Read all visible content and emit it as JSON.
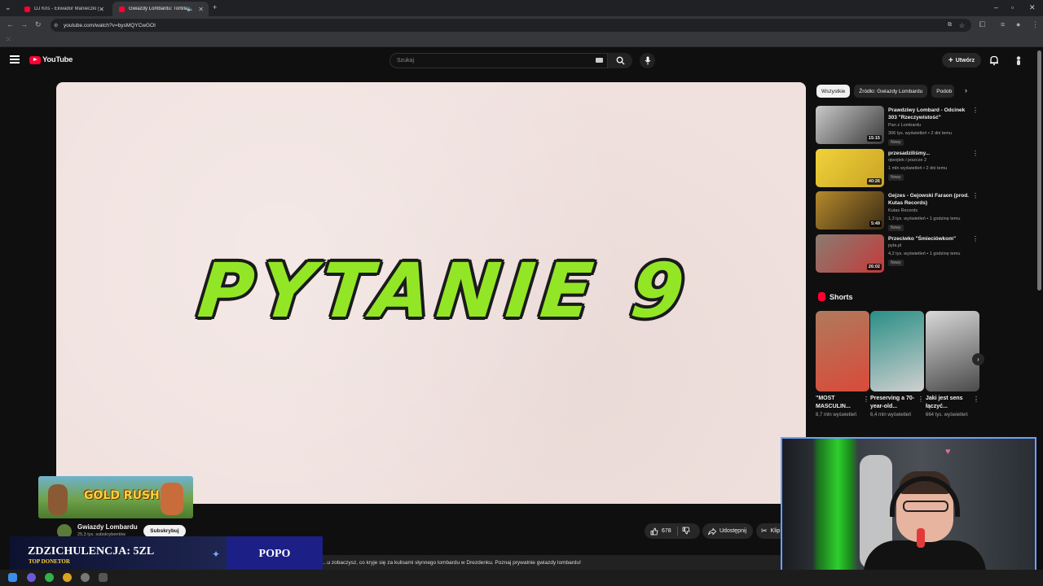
{
  "browser": {
    "tabs": [
      {
        "title": "DJ Kris - Ekwador Manieczki | ..."
      },
      {
        "title": "Gwiazdy Lombardu: Tortilla..."
      }
    ],
    "url": "youtube.com/watch?v=bysMQYCwGOI"
  },
  "header": {
    "logo_text": "YouTube",
    "search_placeholder": "Szukaj",
    "create_label": "Utwórz"
  },
  "player": {
    "video_text": "PYTANIE 9"
  },
  "channel": {
    "name": "Gwiazdy Lombardu",
    "subscribers": "25,3 tys. subskrybentów",
    "subscribe_label": "Subskrybuj"
  },
  "actions": {
    "likes": "678",
    "share_label": "Udostępnij",
    "clip_label": "Klip"
  },
  "description": {
    "text": "…u zobaczysz, co kryje się za kulisami słynnego lombardu w Drezdenku. Poznaj prywatnie gwiazdy lombardu!"
  },
  "chips": [
    "Wszystkie",
    "Źródło: Gwiazdy Lombardu",
    "Podob"
  ],
  "recommendations": [
    {
      "title": "Prawdziwy Lombard - Odcinek 303 \"Rzeczywistość\"",
      "channel": "Pan z Lombardu",
      "meta": "306 tys. wyświetleń • 2 dni temu",
      "badge": "Nowy",
      "duration": "15:15",
      "colors": [
        "#c9c9c9",
        "#3b3b3b"
      ]
    },
    {
      "title": "przesadziliśmy...",
      "channel": "ojwojtek i jeszcze 2",
      "meta": "1 mln wyświetleń • 2 dni temu",
      "badge": "Nowy",
      "duration": "40:26",
      "colors": [
        "#f0d23a",
        "#c9a323"
      ]
    },
    {
      "title": "Gejzes - Gejowski Faraon (prod. Kutas Records)",
      "channel": "Kutas Records",
      "meta": "1,3 tys. wyświetleń • 1 godzinę temu",
      "badge": "Nowy",
      "duration": "5:49",
      "colors": [
        "#b58a2c",
        "#3a2a14"
      ]
    },
    {
      "title": "Przeciwko \"Śmieciówkom\"",
      "channel": "pyta.pl",
      "meta": "4,2 tys. wyświetleń • 1 godzinę temu",
      "badge": "Nowy",
      "duration": "26:02",
      "colors": [
        "#8a7b70",
        "#c43b3b"
      ]
    }
  ],
  "shorts": {
    "heading": "Shorts",
    "items": [
      {
        "title": "\"MOST MASCULIN...",
        "views": "8,7 mln wyświetleń",
        "colors": [
          "#b07a5c",
          "#d94a3a"
        ]
      },
      {
        "title": "Preserving a 70-year-old...",
        "views": "6,4 mln wyświetleń",
        "colors": [
          "#2a8f86",
          "#cfcfcf"
        ]
      },
      {
        "title": "Jaki jest sens łączyć...",
        "views": "664 tys. wyświetleń",
        "colors": [
          "#d8d8d8",
          "#4a4a4a"
        ]
      }
    ]
  },
  "overlay": {
    "game_title": "GOLD RUSH",
    "donation_top": "ZDZICHULENCJA: 5ZL",
    "donation_sub": "TOP DONETOR",
    "donation_name": "POPO"
  }
}
